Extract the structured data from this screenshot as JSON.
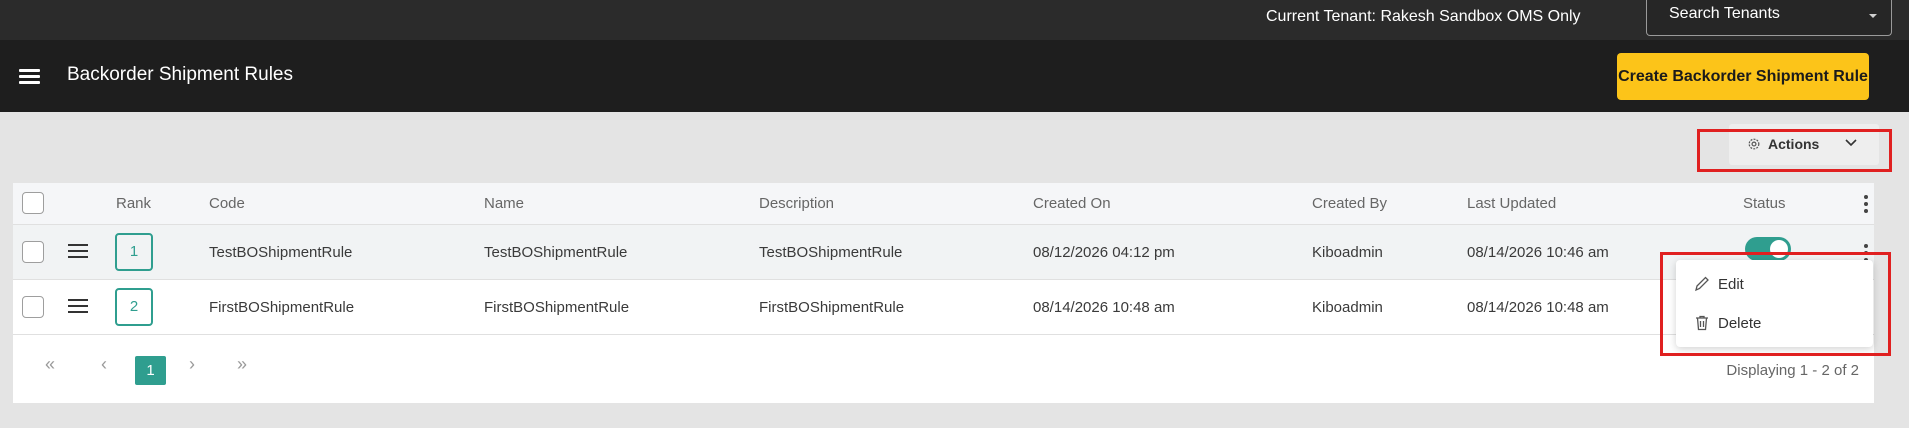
{
  "topbar": {
    "tenant_text": "Current Tenant: Rakesh Sandbox OMS Only",
    "search_tenants_label": "Search Tenants"
  },
  "header": {
    "title": "Backorder Shipment Rules",
    "create_button_label": "Create Backorder Shipment Rule",
    "brand_color": "#fcc419"
  },
  "toolbar": {
    "actions_label": "Actions"
  },
  "table": {
    "columns": [
      "Rank",
      "Code",
      "Name",
      "Description",
      "Created On",
      "Created By",
      "Last Updated",
      "Status"
    ],
    "rows": [
      {
        "rank": "1",
        "code": "TestBOShipmentRule",
        "name": "TestBOShipmentRule",
        "description": "TestBOShipmentRule",
        "created_on": "08/12/2026 04:12 pm",
        "created_by": "Kiboadmin",
        "last_updated": "08/14/2026 10:46 am",
        "status_enabled": true
      },
      {
        "rank": "2",
        "code": "FirstBOShipmentRule",
        "name": "FirstBOShipmentRule",
        "description": "FirstBOShipmentRule",
        "created_on": "08/14/2026 10:48 am",
        "created_by": "Kiboadmin",
        "last_updated": "08/14/2026 10:48 am",
        "status_enabled": null
      }
    ],
    "accent_color": "#2f9e8f"
  },
  "pagination": {
    "current_page": "1",
    "display_text": "Displaying 1 - 2 of 2"
  },
  "row_menu": {
    "items": [
      {
        "label": "Edit",
        "icon": "pencil-icon"
      },
      {
        "label": "Delete",
        "icon": "trash-icon"
      }
    ]
  },
  "highlight_color": "#e02020"
}
